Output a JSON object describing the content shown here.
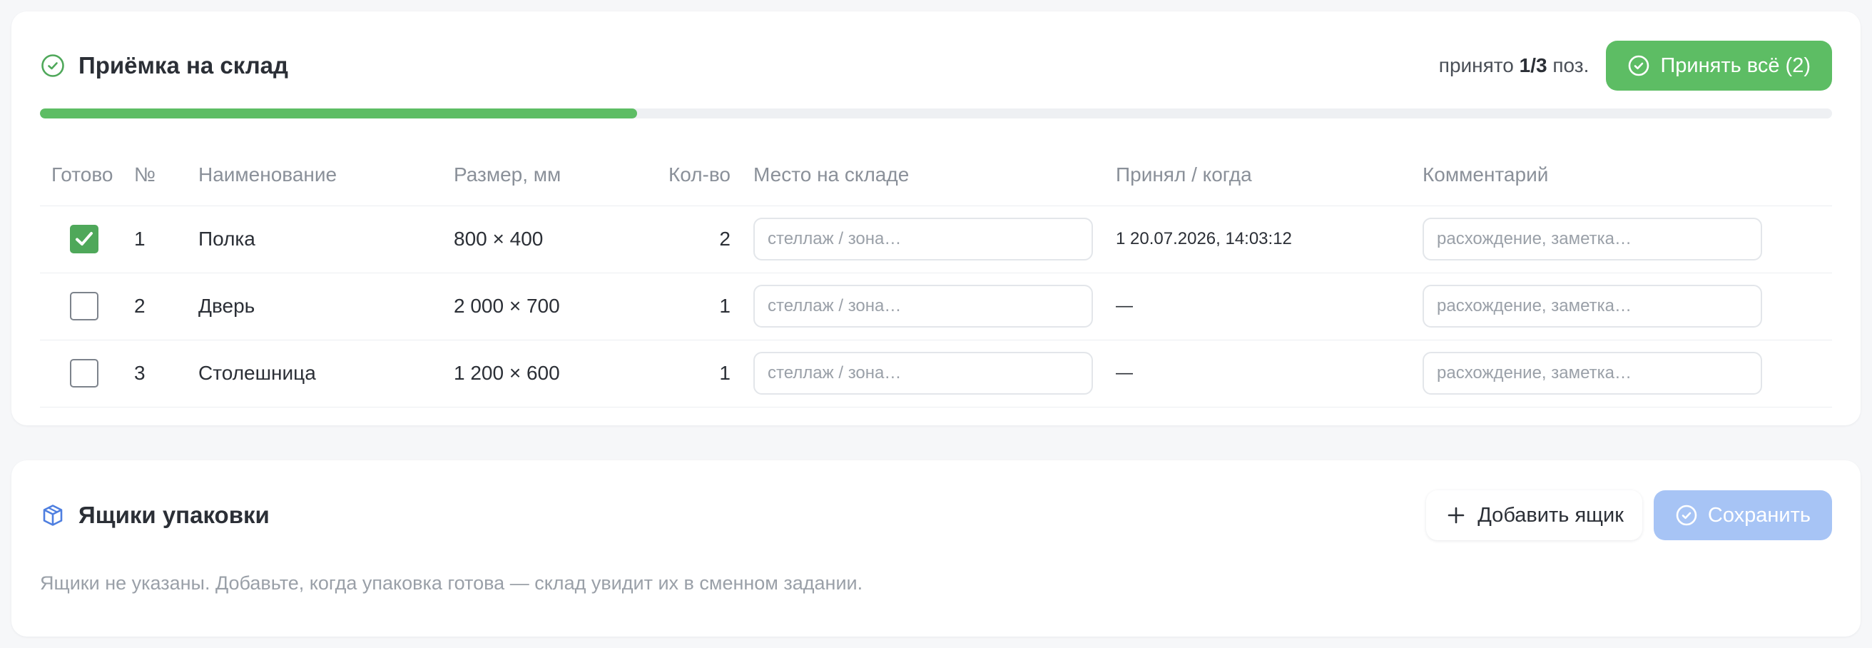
{
  "reception": {
    "title": "Приёмка на склад",
    "accepted_prefix": "принято ",
    "accepted_value": "1/3",
    "accepted_suffix": " поз.",
    "accept_all_label": "Принять всё (2)",
    "progress_fraction": 0.3333,
    "columns": {
      "done": "Готово",
      "num": "№",
      "name": "Наименование",
      "size": "Размер, мм",
      "qty": "Кол-во",
      "place": "Место на складе",
      "who": "Принял / когда",
      "comment": "Комментарий"
    },
    "rows": [
      {
        "checked": true,
        "num": "1",
        "name": "Полка",
        "size": "800 × 400",
        "qty": "2",
        "place_placeholder": "стеллаж / зона…",
        "who": "1 20.07.2026, 14:03:12",
        "comment_placeholder": "расхождение, заметка…"
      },
      {
        "checked": false,
        "num": "2",
        "name": "Дверь",
        "size": "2 000 × 700",
        "qty": "1",
        "place_placeholder": "стеллаж / зона…",
        "who": "—",
        "comment_placeholder": "расхождение, заметка…"
      },
      {
        "checked": false,
        "num": "3",
        "name": "Столешница",
        "size": "1 200 × 600",
        "qty": "1",
        "place_placeholder": "стеллаж / зона…",
        "who": "—",
        "comment_placeholder": "расхождение, заметка…"
      }
    ]
  },
  "boxes": {
    "title": "Ящики упаковки",
    "add_label": "Добавить ящик",
    "save_label": "Сохранить",
    "empty_text": "Ящики не указаны. Добавьте, когда упаковка готова — склад увидит их в сменном задании."
  },
  "colors": {
    "accent_green": "#5dbd64",
    "check_green": "#4fa85a",
    "save_blue_disabled": "#a7c4f5",
    "box_icon_blue": "#4f7fe0"
  },
  "icons": {
    "reception_title": "check-circle-icon",
    "accept_all": "check-circle-icon",
    "boxes_title": "package-icon",
    "add_box": "plus-icon",
    "save": "check-circle-icon",
    "row_checked": "checkmark-icon"
  }
}
